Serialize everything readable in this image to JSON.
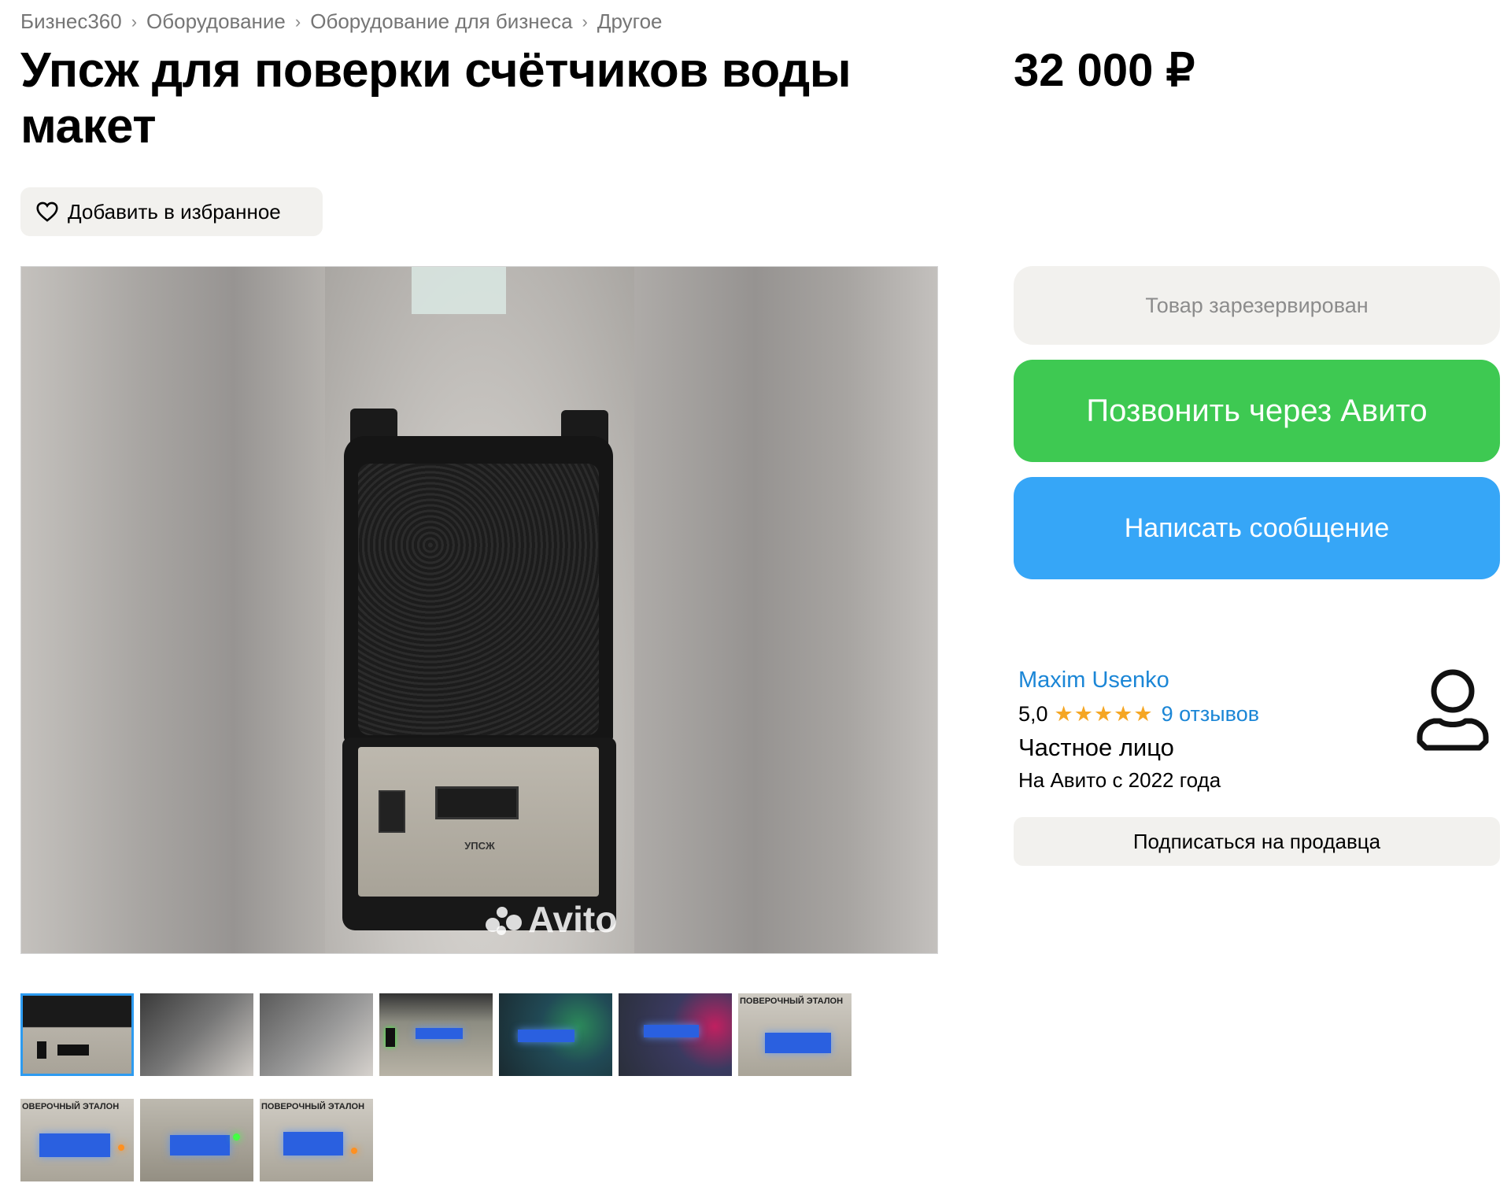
{
  "breadcrumb": [
    "Бизнес360",
    "Оборудование",
    "Оборудование для бизнеса",
    "Другое"
  ],
  "listing": {
    "title": "Упсж для поверки счётчиков воды макет",
    "price": "32 000 ₽"
  },
  "favorite": {
    "label": "Добавить в избранное",
    "icon": "heart-icon"
  },
  "gallery": {
    "watermark": "Avito",
    "photo_labels": {
      "device": "УПСЖ"
    },
    "thumbnail_count": 10,
    "active_index": 0,
    "thumbnail_captions": [
      "",
      "",
      "",
      "",
      "",
      "",
      "ПОВЕРОЧНЫЙ ЭТАЛОН",
      "ОВЕРОЧНЫЙ ЭТАЛОН",
      "",
      "ПОВЕРОЧНЫЙ ЭТАЛОН"
    ]
  },
  "actions": {
    "reserved": "Товар зарезервирован",
    "call": "Позвонить через Авито",
    "message": "Написать сообщение",
    "subscribe": "Подписаться на продавца"
  },
  "seller": {
    "name": "Maxim Usenko",
    "rating": "5,0",
    "stars": "★★★★★",
    "reviews": "9 отзывов",
    "type": "Частное лицо",
    "since": "На Авито с 2022 года"
  },
  "colors": {
    "accent_link": "#1b86d6",
    "call_green": "#3ec952",
    "message_blue": "#36a6f7",
    "star": "#f5a623",
    "active_thumb": "#2d9bf0"
  }
}
